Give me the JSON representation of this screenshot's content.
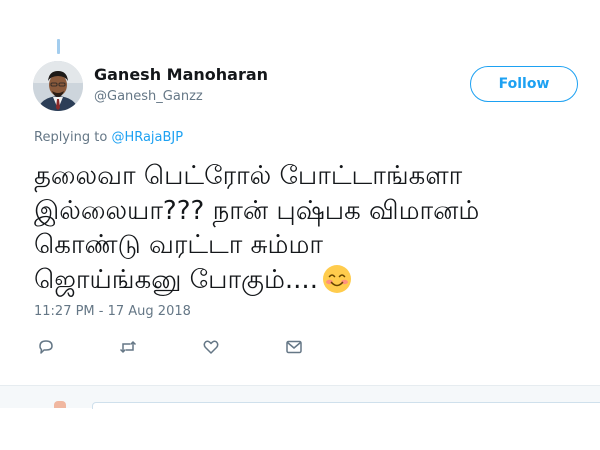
{
  "author": {
    "name": "Ganesh Manoharan",
    "handle": "@Ganesh_Ganzz"
  },
  "follow_button": {
    "label": "Follow",
    "color": "#1da1f2"
  },
  "reply": {
    "prefix": "Replying to",
    "mention": "@HRajaBJP"
  },
  "tweet": {
    "lines": [
      "தலைவா பெட்ரோல் போட்டாங்களா",
      "இல்லையா??? நான் புஷ்பக விமானம்",
      "கொண்டு வரட்டா சும்மா",
      "ஜொய்ங்கனு போகும்...."
    ],
    "emoji": "smiling-face-with-smiling-eyes"
  },
  "timestamp": "11:27 PM - 17 Aug 2018",
  "actions": [
    "reply-icon",
    "retweet-icon",
    "like-icon",
    "direct-message-icon"
  ],
  "colors": {
    "accent": "#1da1f2",
    "secondary_text": "#657786",
    "primary_text": "#14171a"
  }
}
